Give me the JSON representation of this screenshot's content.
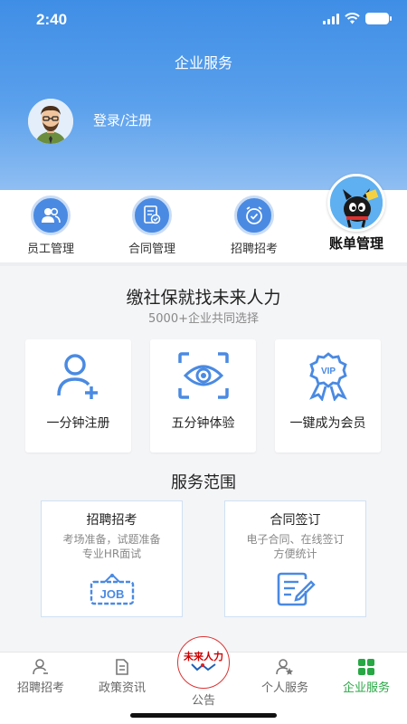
{
  "status": {
    "time": "2:40"
  },
  "header": {
    "title": "企业服务",
    "login_label": "登录/注册"
  },
  "functions": [
    {
      "label": "员工管理",
      "icon": "users-icon"
    },
    {
      "label": "合同管理",
      "icon": "contract-icon"
    },
    {
      "label": "招聘招考",
      "icon": "clock-icon"
    },
    {
      "label": "账单管理",
      "icon": "mascot-badge"
    }
  ],
  "promo": {
    "slogan": "缴社保就找未来人力",
    "subtitle": "5000+企业共同选择",
    "features": [
      {
        "label": "一分钟注册",
        "icon": "add-user-icon"
      },
      {
        "label": "五分钟体验",
        "icon": "eye-scan-icon"
      },
      {
        "label": "一键成为会员",
        "icon": "vip-badge-icon"
      }
    ]
  },
  "services": {
    "title": "服务范围",
    "cards": [
      {
        "title": "招聘招考",
        "desc_line1": "考场准备，试题准备",
        "desc_line2": "专业HR面试",
        "icon": "job-sign-icon"
      },
      {
        "title": "合同签订",
        "desc_line1": "电子合同、在线签订",
        "desc_line2": "方便统计",
        "icon": "document-edit-icon"
      }
    ]
  },
  "tabs": [
    {
      "label": "招聘招考",
      "icon": "person-icon"
    },
    {
      "label": "政策资讯",
      "icon": "news-icon"
    },
    {
      "label": "公告",
      "logo_text": "未来人力",
      "icon": "brand-logo"
    },
    {
      "label": "个人服务",
      "icon": "person-star-icon"
    },
    {
      "label": "企业服务",
      "icon": "grid-icon",
      "active": true
    }
  ],
  "colors": {
    "primary": "#4a8ae2",
    "active_tab": "#28a745",
    "header_top": "#3f8ee6"
  }
}
